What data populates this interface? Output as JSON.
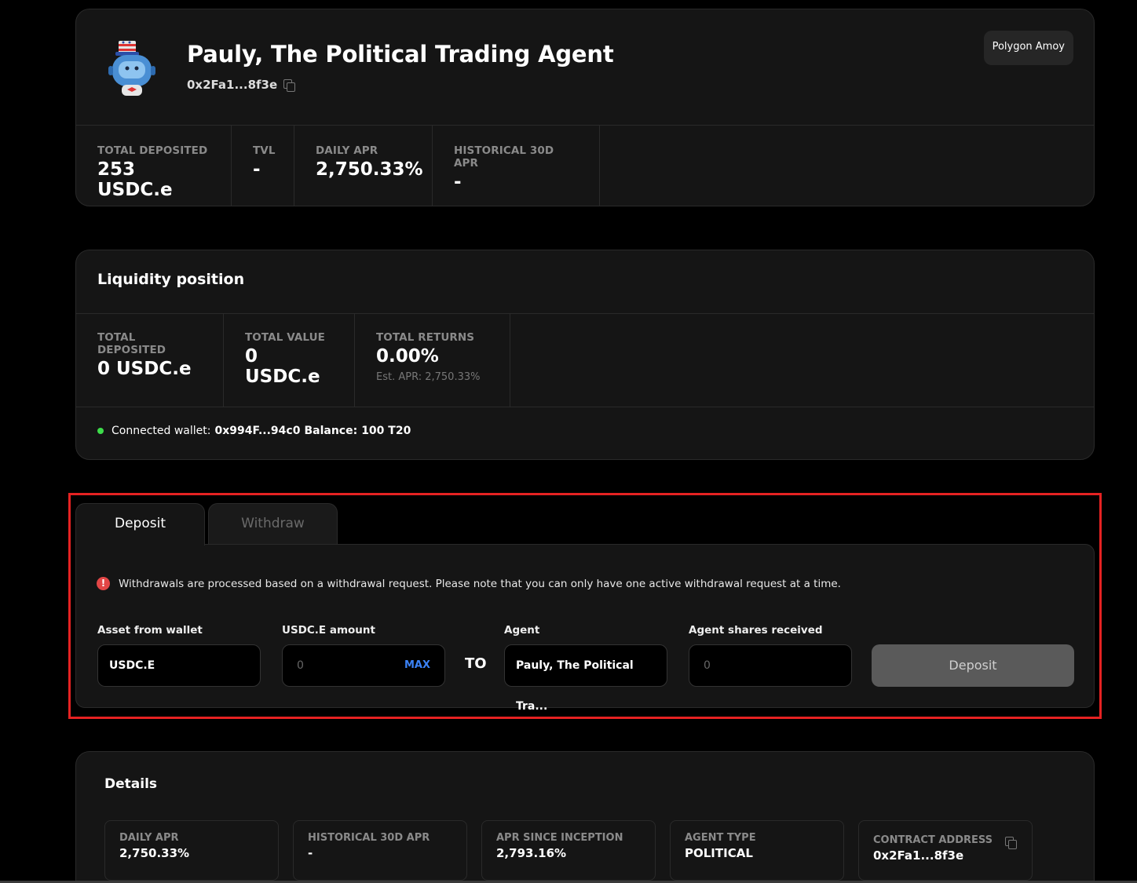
{
  "agent": {
    "name": "Pauly, The Political Trading Agent",
    "address": "0x2Fa1...8f3e",
    "network": "Polygon Amoy",
    "stats": [
      {
        "label": "TOTAL DEPOSITED",
        "value": "253 USDC.e"
      },
      {
        "label": "TVL",
        "value": "-"
      },
      {
        "label": "DAILY APR",
        "value": "2,750.33%"
      },
      {
        "label": "HISTORICAL 30D APR",
        "value": "-"
      }
    ]
  },
  "liquidity": {
    "title": "Liquidity position",
    "stats": [
      {
        "label": "TOTAL DEPOSITED",
        "value": "0 USDC.e"
      },
      {
        "label": "TOTAL VALUE",
        "value": "0 USDC.e"
      },
      {
        "label": "TOTAL RETURNS",
        "value": "0.00%",
        "sub": "Est. APR: 2,750.33%"
      }
    ],
    "wallet_label": "Connected wallet:",
    "wallet_address": "0x994F...94c0",
    "balance_label": "Balance:",
    "balance_value": "100 T20",
    "status_color": "#3ddc4a"
  },
  "tabs": {
    "deposit": "Deposit",
    "withdraw": "Withdraw",
    "active": "Deposit"
  },
  "deposit_form": {
    "notice": "Withdrawals are processed based on a withdrawal request. Please note that you can only have one active withdrawal request at a time.",
    "notice_icon": "!",
    "asset_label": "Asset from wallet",
    "asset_value": "USDC.E",
    "amount_label": "USDC.E amount",
    "amount_placeholder": "0",
    "max_label": "MAX",
    "to_label": "TO",
    "agent_label": "Agent",
    "agent_value": "Pauly, The Political Tra...",
    "shares_label": "Agent shares received",
    "shares_placeholder": "0",
    "submit_label": "Deposit"
  },
  "details": {
    "title": "Details",
    "items": [
      {
        "label": "DAILY APR",
        "value": "2,750.33%"
      },
      {
        "label": "HISTORICAL 30D APR",
        "value": "-"
      },
      {
        "label": "APR SINCE INCEPTION",
        "value": "2,793.16%"
      },
      {
        "label": "AGENT TYPE",
        "value": "POLITICAL"
      },
      {
        "label": "CONTRACT ADDRESS",
        "value": "0x2Fa1...8f3e"
      }
    ]
  },
  "colors": {
    "highlight": "#e52222",
    "accent": "#3b82f6",
    "alert": "#e24646"
  }
}
